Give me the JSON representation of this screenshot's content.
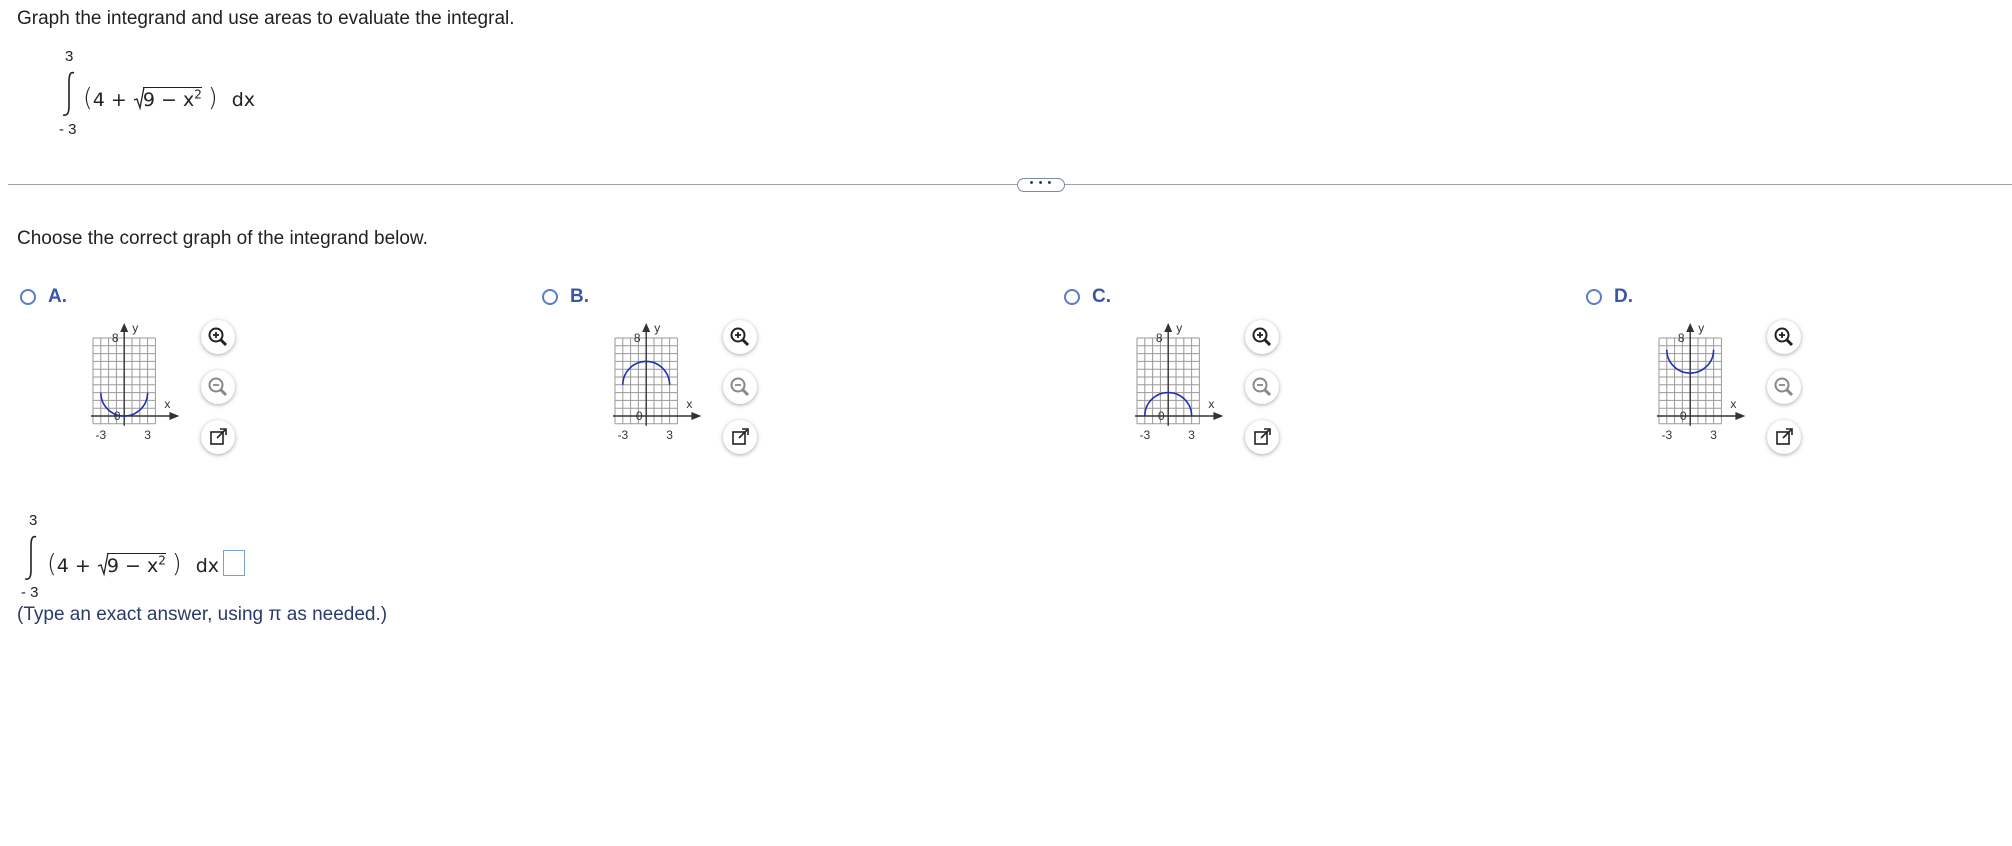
{
  "question": {
    "prompt": "Graph the integrand and use areas to evaluate the integral.",
    "integral": {
      "upper": "3",
      "lower": "- 3",
      "open": "(",
      "term_a": "4 +",
      "radicand": "9 − x",
      "exponent": "2",
      "close": ")",
      "differential": "dx"
    }
  },
  "divider": {
    "handle_label": "• • •"
  },
  "instruction": "Choose the correct graph of the integrand below.",
  "options": [
    {
      "letter": "A.",
      "y_label": "y",
      "x_label": "x",
      "y_tick": "8",
      "origin": "0",
      "x_min": "-3",
      "x_max": "3",
      "curve": "lower-semicircle-bottom"
    },
    {
      "letter": "B.",
      "y_label": "y",
      "x_label": "x",
      "y_tick": "8",
      "origin": "0",
      "x_min": "-3",
      "x_max": "3",
      "curve": "upper-semicircle-top"
    },
    {
      "letter": "C.",
      "y_label": "y",
      "x_label": "x",
      "y_tick": "8",
      "origin": "0",
      "x_min": "-3",
      "x_max": "3",
      "curve": "upper-semicircle-bottom"
    },
    {
      "letter": "D.",
      "y_label": "y",
      "x_label": "x",
      "y_tick": "8",
      "origin": "0",
      "x_min": "-3",
      "x_max": "3",
      "curve": "lower-semicircle-top"
    }
  ],
  "tools": {
    "zoom_in": "zoom-in-icon",
    "zoom_out": "zoom-out-icon",
    "popout": "popout-icon"
  },
  "answer": {
    "integral": {
      "upper": "3",
      "lower": "- 3",
      "open": "(",
      "term_a": "4 +",
      "radicand": "9 − x",
      "exponent": "2",
      "close": ")",
      "differential": "dx ="
    },
    "value": "",
    "hint": "(Type an exact answer, using π as needed.)"
  },
  "colors": {
    "curve": "#1f2fb0",
    "grid": "#9a9a9a",
    "accent": "#3a56a8"
  }
}
